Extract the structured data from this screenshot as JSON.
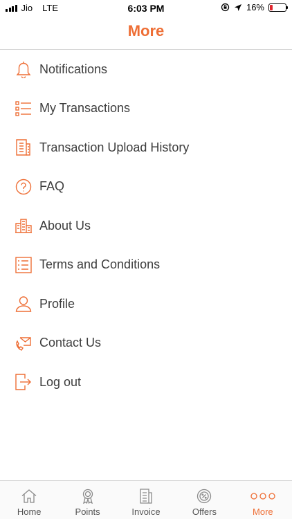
{
  "status_bar": {
    "carrier": "Jio",
    "network": "LTE",
    "time": "6:03 PM",
    "battery_percent": "16%",
    "battery_level": 0.16,
    "battery_color": "#e0262e"
  },
  "header": {
    "title": "More",
    "accent_color": "#ee6e35"
  },
  "menu": {
    "items": [
      {
        "label": "Notifications",
        "icon": "bell-icon"
      },
      {
        "label": "My Transactions",
        "icon": "list-icon"
      },
      {
        "label": "Transaction Upload History",
        "icon": "receipt-icon"
      },
      {
        "label": "FAQ",
        "icon": "question-icon"
      },
      {
        "label": "About Us",
        "icon": "building-icon"
      },
      {
        "label": "Terms and Conditions",
        "icon": "checklist-icon"
      },
      {
        "label": "Profile",
        "icon": "user-icon"
      },
      {
        "label": "Contact Us",
        "icon": "phone-mail-icon"
      },
      {
        "label": "Log out",
        "icon": "logout-icon"
      }
    ]
  },
  "tab_bar": {
    "tabs": [
      {
        "label": "Home",
        "icon": "home-icon"
      },
      {
        "label": "Points",
        "icon": "award-icon"
      },
      {
        "label": "Invoice",
        "icon": "invoice-icon"
      },
      {
        "label": "Offers",
        "icon": "offer-icon"
      },
      {
        "label": "More",
        "icon": "more-icon",
        "active": true
      }
    ]
  }
}
